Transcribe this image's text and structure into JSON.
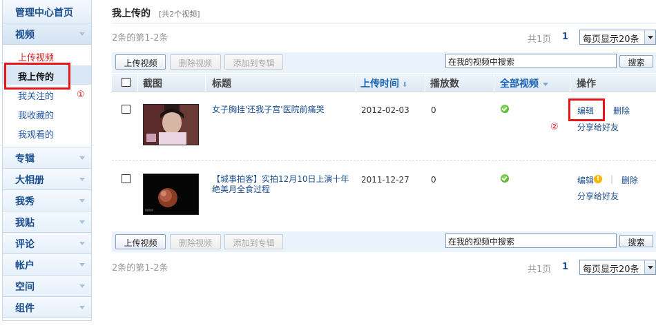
{
  "sidebar": {
    "home": "管理中心首页",
    "video_category": "视频",
    "video_items": [
      "上传视频",
      "我上传的",
      "我关注的",
      "我收藏的",
      "我观看的"
    ],
    "categories": [
      "专辑",
      "大相册",
      "我秀",
      "我贴",
      "评论",
      "帐户",
      "空间",
      "组件"
    ]
  },
  "page": {
    "title": "我上传的",
    "count": "[共2个视频]"
  },
  "pagination": {
    "summary": "2条的第1-2条",
    "total_pages": "共1页",
    "current_page": "1",
    "per_page": "每页显示20条"
  },
  "toolbar": {
    "upload": "上传视频",
    "delete": "删除视频",
    "add_to_album": "添加到专辑",
    "search_value": "在我的视频中搜索",
    "search_button": "搜索"
  },
  "table": {
    "headers": {
      "thumb": "截图",
      "title": "标题",
      "upload_time": "上传时间",
      "plays": "播放数",
      "all_videos": "全部视频",
      "ops": "操作"
    },
    "rows": [
      {
        "title": "女子胸挂'还我子宫'医院前痛哭",
        "date": "2012-02-03",
        "plays": "0",
        "status_icon": "check-icon",
        "edit": "编辑",
        "delete": "删除",
        "share": "分享给好友"
      },
      {
        "title": "【城事拍客】实拍12月10日上演十年绝美月全食过程",
        "date": "2011-12-27",
        "plays": "0",
        "status_icon": "check-icon",
        "edit": "编辑",
        "delete": "删除",
        "share": "分享给好友"
      }
    ],
    "separator": "|"
  },
  "annotations": {
    "mark1": "①",
    "mark2": "②"
  },
  "colors": {
    "link": "#1a4e8f",
    "annotation": "#e8161b",
    "header_bg": "#dfe9f4"
  }
}
